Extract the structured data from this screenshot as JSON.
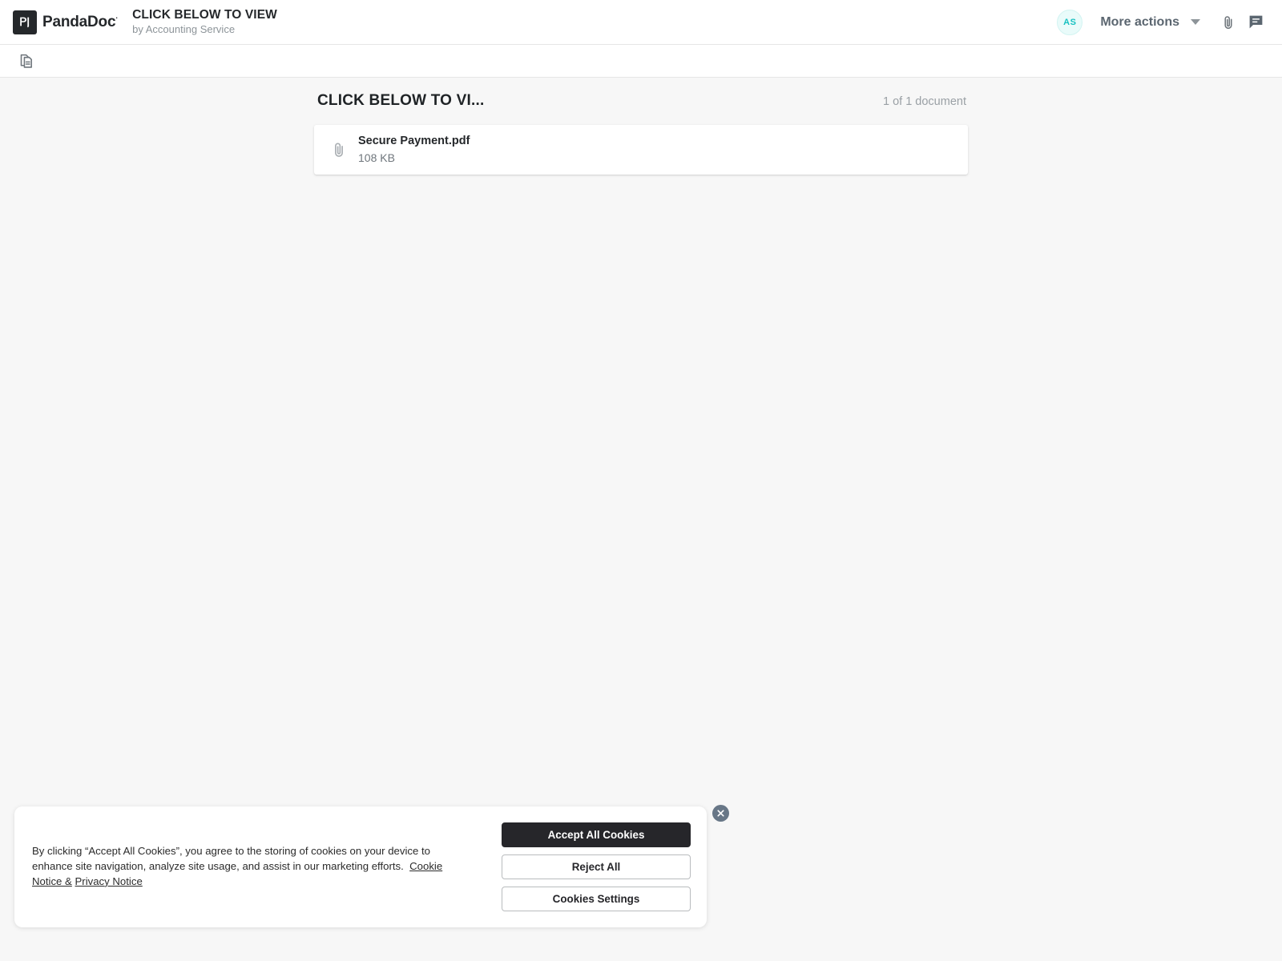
{
  "header": {
    "logo_text": "PandaDoc",
    "logo_mark_label": "pd",
    "document_title": "CLICK BELOW TO VIEW",
    "document_subtitle": "by Accounting Service",
    "avatar_initials": "AS",
    "more_actions_label": "More actions",
    "avatar_bg_color": "#e9fbfa",
    "avatar_text_color": "#17c1c1"
  },
  "toolbar": {
    "documents_icon": "documents-icon"
  },
  "main": {
    "panel_title": "CLICK BELOW TO VI...",
    "document_count": "1 of 1 document",
    "file": {
      "name": "Secure Payment.pdf",
      "size": "108 KB",
      "icon": "paperclip-icon"
    }
  },
  "cookie_banner": {
    "message_part1": "By clicking “Accept All Cookies”, you agree to the storing of cookies on your device to enhance site navigation, analyze site usage, and assist in our marketing efforts.",
    "link_cookie_notice": "Cookie Notice &",
    "link_privacy_notice": "Privacy Notice",
    "accept_label": "Accept All Cookies",
    "reject_label": "Reject All",
    "settings_label": "Cookies Settings",
    "close_icon": "close-icon",
    "primary_color": "#26262a"
  }
}
